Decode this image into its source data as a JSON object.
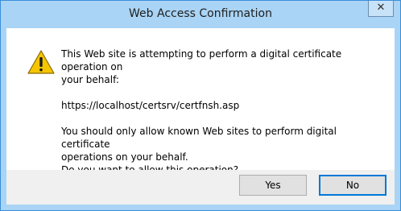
{
  "window": {
    "title": "Web Access Confirmation",
    "close_glyph": "✕"
  },
  "message": {
    "line1": "This Web site is attempting to perform a digital certificate operation on",
    "line2": "your behalf:",
    "url": "https://localhost/certsrv/certfnsh.asp",
    "line3": "You should only allow known Web sites to perform digital certificate",
    "line4": "operations on your behalf.",
    "line5": "Do you want to allow this operation?"
  },
  "buttons": {
    "yes_label": "Yes",
    "no_label": "No"
  },
  "icons": {
    "warning": "warning-icon",
    "close": "close-icon"
  },
  "colors": {
    "titlebar": "#a9d4f5",
    "warning_fill": "#f5c500",
    "default_button_border": "#0078d7"
  }
}
